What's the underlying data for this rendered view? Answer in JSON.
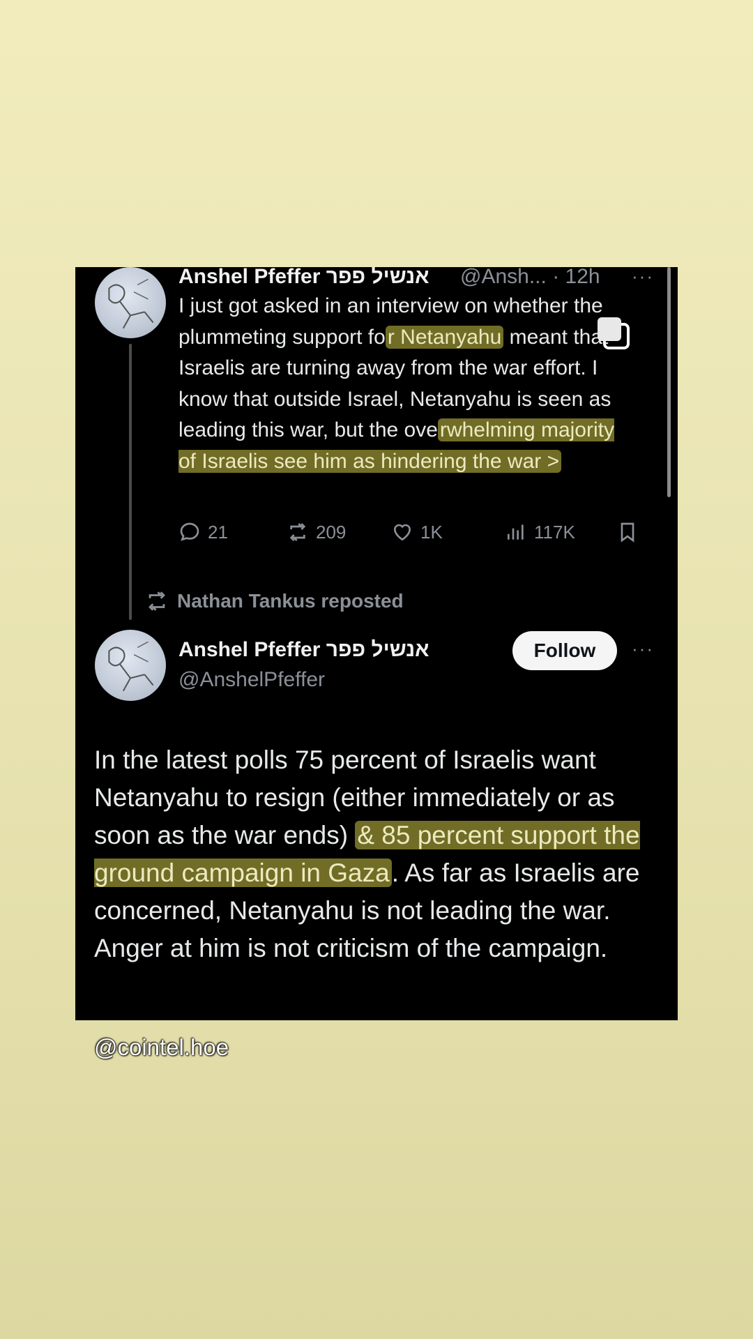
{
  "tweet1": {
    "author_name": "Anshel Pfeffer אנשיל פפר",
    "handle": "@Ansh...",
    "time": "· 12h",
    "more": "···",
    "text_parts": [
      "I just got asked in an interview on whether the plummeting support fo",
      "r Netanyahu",
      " meant that Israelis are turning away from the war effort. I know that outside Israel, Netanyahu is seen as leading this war, but the ove",
      "rwhelming majority of Israelis see him as hindering the war >"
    ],
    "replies": "21",
    "reposts": "209",
    "likes": "1K",
    "views": "117K"
  },
  "repost_label": "Nathan Tankus reposted",
  "tweet2": {
    "author_name": "Anshel Pfeffer אנשיל פפר",
    "handle": "@AnshelPfeffer",
    "follow_label": "Follow",
    "more": "···",
    "text_parts": [
      "In the latest polls 75 percent of Israelis want Netanyahu to resign (either immediately or as soon as the war ends) ",
      "& 85 percent support the ground campaign in Gaza",
      ". As far as Israelis are concerned, Netanyahu is not leading the war. Anger at him is not criticism of the campaign."
    ]
  },
  "watermark": "@cointel.hoe",
  "colors": {
    "highlight": "#cdc646",
    "card_bg": "#000000",
    "page_bg": "#ebe6b5"
  },
  "icons": [
    "reply-icon",
    "repost-icon",
    "like-icon",
    "views-icon",
    "bookmark-icon",
    "copy-icon"
  ]
}
